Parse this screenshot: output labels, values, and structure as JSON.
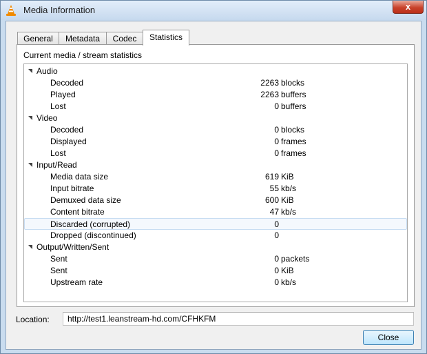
{
  "window": {
    "title": "Media Information",
    "close_glyph": "x",
    "icon": "vlc-cone-icon"
  },
  "tabs": [
    {
      "label": "General",
      "active": false
    },
    {
      "label": "Metadata",
      "active": false
    },
    {
      "label": "Codec",
      "active": false
    },
    {
      "label": "Statistics",
      "active": true
    }
  ],
  "statistics": {
    "header": "Current media / stream statistics",
    "groups": [
      {
        "label": "Audio",
        "items": [
          {
            "label": "Decoded",
            "value": "2263",
            "unit": "blocks"
          },
          {
            "label": "Played",
            "value": "2263",
            "unit": "buffers"
          },
          {
            "label": "Lost",
            "value": "0",
            "unit": "buffers"
          }
        ]
      },
      {
        "label": "Video",
        "items": [
          {
            "label": "Decoded",
            "value": "0",
            "unit": "blocks"
          },
          {
            "label": "Displayed",
            "value": "0",
            "unit": "frames"
          },
          {
            "label": "Lost",
            "value": "0",
            "unit": "frames"
          }
        ]
      },
      {
        "label": "Input/Read",
        "items": [
          {
            "label": "Media data size",
            "value": "619",
            "unit": "KiB"
          },
          {
            "label": "Input bitrate",
            "value": "55",
            "unit": "kb/s"
          },
          {
            "label": "Demuxed data size",
            "value": "600",
            "unit": "KiB"
          },
          {
            "label": "Content bitrate",
            "value": "47",
            "unit": "kb/s"
          },
          {
            "label": "Discarded (corrupted)",
            "value": "0",
            "unit": ""
          },
          {
            "label": "Dropped (discontinued)",
            "value": "0",
            "unit": ""
          }
        ]
      },
      {
        "label": "Output/Written/Sent",
        "items": [
          {
            "label": "Sent",
            "value": "0",
            "unit": "packets"
          },
          {
            "label": "Sent",
            "value": "0",
            "unit": "KiB"
          },
          {
            "label": "Upstream rate",
            "value": "0",
            "unit": "kb/s"
          }
        ]
      }
    ]
  },
  "location": {
    "label": "Location:",
    "value": "http://test1.leanstream-hd.com/CFHKFM"
  },
  "buttons": {
    "close_label": "Close"
  }
}
